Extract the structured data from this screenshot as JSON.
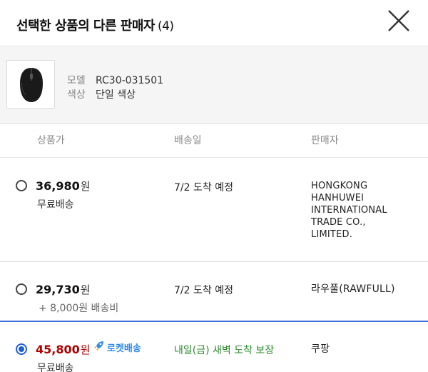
{
  "header": {
    "title": "선택한 상품의 다른 판매자",
    "count": "(4)",
    "close_icon": "close-icon"
  },
  "product": {
    "thumbnail_icon": "mouse-icon",
    "model_label": "모델",
    "model_value": "RC30-031501",
    "color_label": "색상",
    "color_value": "단일 색상"
  },
  "columns": {
    "price": "상품가",
    "delivery": "배송일",
    "seller": "판매자"
  },
  "offers": [
    {
      "selected": false,
      "price": "36,980",
      "won": "원",
      "shipping": "무료배송",
      "delivery": "7/2 도착 예정",
      "seller_lines": [
        "HONGKONG",
        "HANHUWEI",
        "INTERNATIONAL",
        "TRADE CO.,",
        "LIMITED."
      ]
    },
    {
      "selected": false,
      "price": "29,730",
      "won": "원",
      "shipping_extra": "+ 8,000원 배송비",
      "delivery": "7/2 도착 예정",
      "seller": "라우풀(RAWFULL)"
    },
    {
      "selected": true,
      "price": "45,800",
      "won": "원",
      "badge": "로켓배송",
      "badge_icon": "rocket-icon",
      "shipping": "무료배송",
      "delivery": "내일(금) 새벽 도착 보장",
      "seller": "쿠팡"
    }
  ],
  "colors": {
    "accent_blue": "#1f5fd8",
    "price_red": "#ae0000",
    "delivery_green": "#2e8b2e",
    "rocket_blue": "#2f8be6"
  }
}
